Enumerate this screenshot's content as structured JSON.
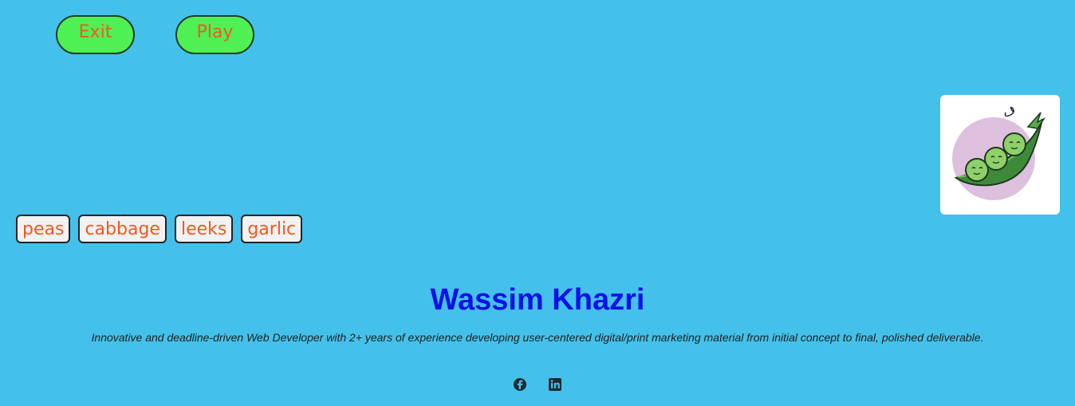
{
  "controls": {
    "exit_label": "Exit",
    "play_label": "Play"
  },
  "words": [
    "peas",
    "cabbage",
    "leeks",
    "garlic"
  ],
  "image": {
    "subject": "cartoon pea pod with three smiling peas",
    "bg_circle_color": "#dcc0dd"
  },
  "profile": {
    "name": "Wassim Khazri",
    "bio": "Innovative and deadline-driven Web Developer with 2+ years of experience developing user-centered digital/print marketing material from initial concept to final, polished deliverable."
  },
  "social": {
    "icons": [
      "facebook-icon",
      "linkedin-icon"
    ]
  },
  "colors": {
    "background": "#43c1ea",
    "button_green": "#4ff054",
    "label_orange": "#f2581f",
    "name_blue": "#0a10ea"
  }
}
